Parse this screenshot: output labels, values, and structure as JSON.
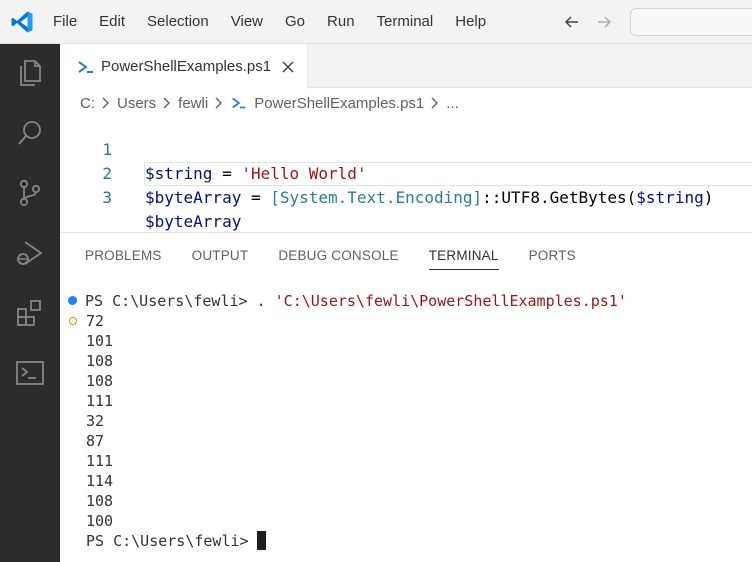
{
  "menu": [
    "File",
    "Edit",
    "Selection",
    "View",
    "Go",
    "Run",
    "Terminal",
    "Help"
  ],
  "tab": {
    "label": "PowerShellExamples.ps1"
  },
  "breadcrumb": {
    "drive": "C:",
    "folder1": "Users",
    "folder2": "fewli",
    "file": "PowerShellExamples.ps1",
    "ellipsis": "..."
  },
  "editor": {
    "lines": [
      {
        "num": "1",
        "tokens": [
          [
            "var",
            "$string"
          ],
          [
            "op",
            " = "
          ],
          [
            "str",
            "'Hello World'"
          ]
        ]
      },
      {
        "num": "2",
        "tokens": [
          [
            "var",
            "$byteArray"
          ],
          [
            "op",
            " = "
          ],
          [
            "type",
            "[System.Text.Encoding]"
          ],
          [
            "op",
            "::UTF8.GetBytes("
          ],
          [
            "var",
            "$string"
          ],
          [
            "op",
            ")"
          ]
        ]
      },
      {
        "num": "3",
        "tokens": [
          [
            "var",
            "$byteArray"
          ]
        ]
      }
    ]
  },
  "panel": {
    "tabs": [
      "PROBLEMS",
      "OUTPUT",
      "DEBUG CONSOLE",
      "TERMINAL",
      "PORTS"
    ],
    "active_tab": "TERMINAL"
  },
  "terminal": {
    "command_prompt": "PS C:\\Users\\fewli> . ",
    "command_path": "'C:\\Users\\fewli\\PowerShellExamples.ps1'",
    "output": [
      "72",
      "101",
      "108",
      "108",
      "111",
      "32",
      "87",
      "111",
      "114",
      "108",
      "100"
    ],
    "final_prompt": "PS C:\\Users\\fewli>"
  },
  "colors": {
    "activity_bar": "#2c2c2c",
    "highlight": "#fde55a",
    "string": "#a31515",
    "variable": "#001080",
    "type": "#267f99",
    "line_number": "#237893",
    "accent": "#1a85ff"
  },
  "icons": {
    "app": "vscode-logo-icon",
    "activity": [
      "explorer-icon",
      "search-icon",
      "source-control-icon",
      "run-debug-icon",
      "extensions-icon",
      "terminal-icon"
    ],
    "file": "powershell-file-icon"
  }
}
